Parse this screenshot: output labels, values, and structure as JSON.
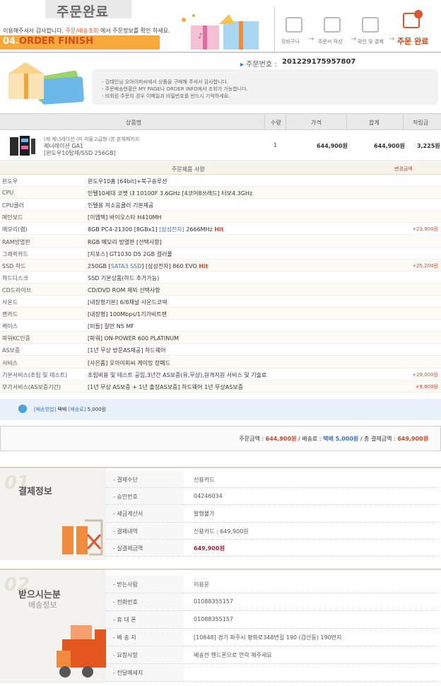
{
  "header": {
    "title": "주문완료",
    "thanks_pre": "이용해주셔서 감사합니다.",
    "thanks_link": "주문/배송조회",
    "thanks_post": "에서 주문정보를 확인 하세요.",
    "step_no": "04.",
    "step_name": "ORDER FINISH",
    "steps": [
      {
        "icon": "cart-icon",
        "label": "장바구니"
      },
      {
        "icon": "order-sheet-icon",
        "label": "주문서 작성"
      },
      {
        "icon": "payment-check-icon",
        "label": "확인 및 결제"
      },
      {
        "icon": "order-complete-icon",
        "label": "주문 완료"
      }
    ],
    "arrow": "→"
  },
  "order": {
    "number_label": "주문번호 :",
    "number": "201229175957807",
    "notice": [
      "- 김태인님 오아이피씨에서 상품을 구매해 주셔서 감사합니다.",
      "- 주문배송현황은 MY PAGE나 ORDER INFO에서 조회가 가능합니다.",
      "- 비회원 주문의 경우 이메일과 비밀번호를 반드시 기억하세요."
    ]
  },
  "product_table": {
    "columns": [
      "상품명",
      "수량",
      "가격",
      "합계",
      "적립금"
    ],
    "rows": [
      {
        "tags": "(제 제너레이션  (미 미들고급형  (본 본체패키지",
        "name": "제너레이션 GA1",
        "spec": "[윈도우10탑재/SSD 256GB]",
        "qty": "1",
        "price": "644,900원",
        "total": "644,900원",
        "points": "3,225원"
      }
    ]
  },
  "options": {
    "header_label": "주문제품 사양",
    "header_change": "변경금액",
    "rows": [
      {
        "key": "윈도우",
        "value": "윈도우10홈 [64bit]+북구송루션",
        "price": ""
      },
      {
        "key": "CPU",
        "value": "인텔10세대 코멧 i3 10100F 3.6GHz [4코어8쓰레드] 터보4.3GHz",
        "price": ""
      },
      {
        "key": "CPU쿨러",
        "value": "인텔용 저소음쿨러 기본제공",
        "price": ""
      },
      {
        "key": "메인보드",
        "value": "[이엠텍] 바이오스타 H410MH",
        "price": ""
      },
      {
        "key": "메모리(램)",
        "value": "8GB PC4-21300 [8GBx1] ",
        "value_link": "[삼성전자]",
        "value_post": " 2666MHz ",
        "value_hot": "Hit",
        "price": "+23,900원"
      },
      {
        "key": "RAM방열판",
        "value": "RGB 메모리 방열판 [선택사항]",
        "price": ""
      },
      {
        "key": "그래픽카드",
        "value": "[지포스] GT1030 D5 2GB 컬러풀",
        "price": ""
      },
      {
        "key": "SSD 하드",
        "value": "250GB [",
        "value_link": "SATA3 SSD",
        "value_post": "] [삼성전자] 860 EVO ",
        "value_hot": "Hit",
        "price": "+25,200원"
      },
      {
        "key": "하드디스크",
        "value": "SSD 기본상품(하드 추가가능)",
        "price": ""
      },
      {
        "key": "CD드라이브",
        "value": "CD/DVD ROM 제외 선택사항",
        "price": ""
      },
      {
        "key": "사운드",
        "value": "[내장형기본] 6/8채널 사운드코덱",
        "price": ""
      },
      {
        "key": "랜카드",
        "value": "[내장형] 100Mbps/1기가비트랜",
        "price": ""
      },
      {
        "key": "케이스",
        "value": "[미들] 잘만 N5 MF",
        "price": ""
      },
      {
        "key": "파워KC인증",
        "value": "[파워] ON-POWER 600 PLATINUM",
        "price": ""
      },
      {
        "key": "AS보증",
        "value": "[1년 무상 방문AS제공] 하드웨어",
        "price": ""
      },
      {
        "key": "서비스",
        "value": "[사은품] 오아이피씨 게이밍 장패드",
        "price": ""
      },
      {
        "key": "기본서비스(조립 및 테스트)",
        "value": "조립비용 및 테스트 공임,3년간 AS보증(유,무상),원격지원 서비스 및 기술료",
        "price": "+29,000원"
      },
      {
        "key": "부가서비스(AS보증기간)",
        "value": "[1년 무상 AS보증 + 1년 출장AS보증] 하드웨어 1년 무상AS보증",
        "price": "+9,800원"
      }
    ]
  },
  "shipping": {
    "method_label": "[배송방법]",
    "method": "택배",
    "fee_label": "[배송료]",
    "fee": "5,000원"
  },
  "totals": {
    "order_label": "주문금액 :",
    "order_amount": "644,900원",
    "ship_label": "/ 배송료 :",
    "ship_amount": "택배 5,000원",
    "pay_label": "/ 총 결제금액 :",
    "pay_amount": "649,900원"
  },
  "payment": {
    "num": "01",
    "title": "결제정보",
    "rows": [
      {
        "key": "- 결제수단",
        "value": "신용카드"
      },
      {
        "key": "- 승인번호",
        "value": "04246034"
      },
      {
        "key": "- 세금계산서",
        "value": "발행불가"
      },
      {
        "key": "- 결제내역",
        "value": "신용카드 : 649,900원"
      },
      {
        "key": "- 실결제금액",
        "value": "649,900원"
      }
    ]
  },
  "receiver": {
    "num": "02",
    "title": "받으시는분",
    "subtitle": "배송정보",
    "rows": [
      {
        "key": "- 받는사람",
        "value": "이용운"
      },
      {
        "key": "- 전화번호",
        "value": "01088355157"
      },
      {
        "key": "- 휴 대 폰",
        "value": "01088355157"
      },
      {
        "key": "- 배 송 지",
        "value": "[10848] 경기 파주시 평화로348번길 190 (검산동) 190번지"
      },
      {
        "key": "- 요청사항",
        "value": "배송전 핸드폰으로 연락 해주세요"
      },
      {
        "key": "- 전달메세지",
        "value": ""
      }
    ]
  },
  "colors": {
    "accent": "#d0472a",
    "orange": "#f7a93c",
    "blue": "#3a76c2"
  }
}
